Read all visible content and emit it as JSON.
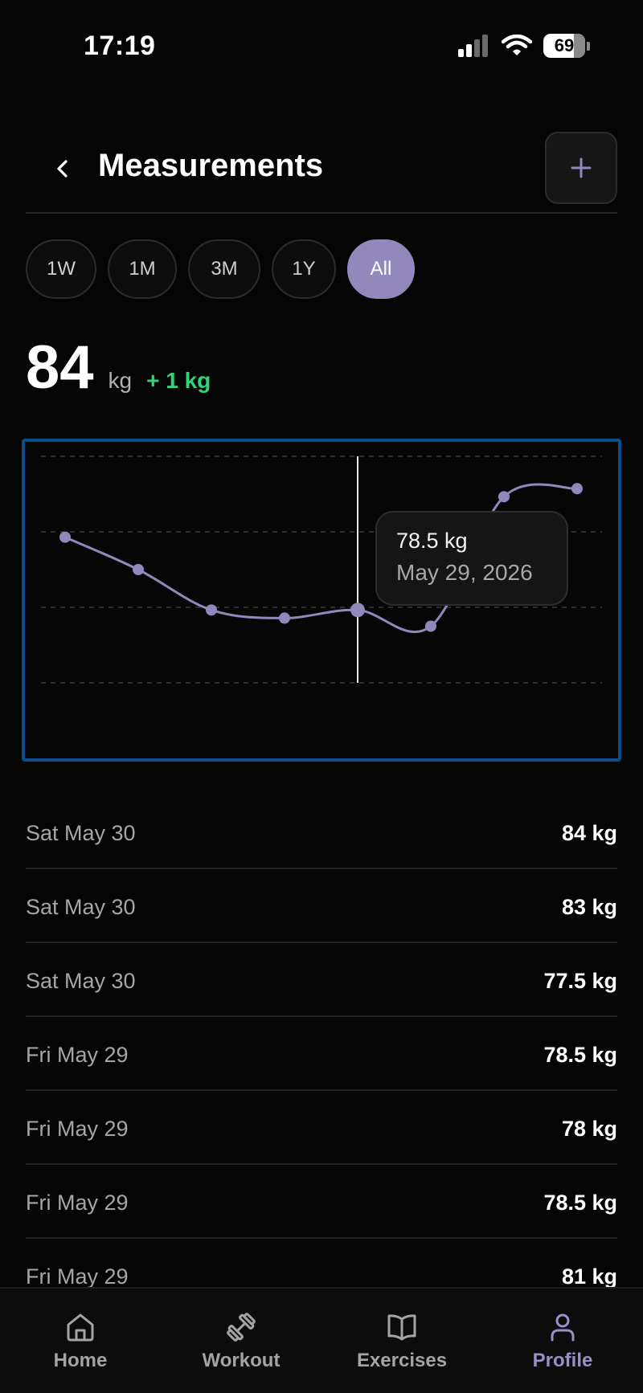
{
  "status_bar": {
    "time": "17:19",
    "battery": "69"
  },
  "header": {
    "title": "Measurements",
    "back_icon": "chevron-left-icon",
    "add_icon": "plus-icon"
  },
  "ranges": [
    {
      "label": "1W",
      "active": false
    },
    {
      "label": "1M",
      "active": false
    },
    {
      "label": "3M",
      "active": false
    },
    {
      "label": "1Y",
      "active": false
    },
    {
      "label": "All",
      "active": true
    }
  ],
  "current": {
    "value": "84",
    "unit": "kg",
    "delta": "+ 1 kg"
  },
  "chart_data": {
    "type": "line",
    "values": [
      81,
      79,
      76.5,
      76,
      76.5,
      75.5,
      83.5,
      84
    ],
    "y_range": [
      72,
      86
    ],
    "grid": "dashed-horizontal",
    "line_color": "#9288bc",
    "selected_index": 4,
    "tooltip": {
      "value": "78.5 kg",
      "date": "May 29, 2026"
    }
  },
  "entries": [
    {
      "date": "Sat May 30",
      "value": "84 kg"
    },
    {
      "date": "Sat May 30",
      "value": "83 kg"
    },
    {
      "date": "Sat May 30",
      "value": "77.5 kg"
    },
    {
      "date": "Fri May 29",
      "value": "78.5 kg"
    },
    {
      "date": "Fri May 29",
      "value": "78 kg"
    },
    {
      "date": "Fri May 29",
      "value": "78.5 kg"
    },
    {
      "date": "Fri May 29",
      "value": "81 kg"
    }
  ],
  "nav": [
    {
      "label": "Home",
      "icon": "home-icon",
      "active": false
    },
    {
      "label": "Workout",
      "icon": "dumbbell-icon",
      "active": false
    },
    {
      "label": "Exercises",
      "icon": "book-icon",
      "active": false
    },
    {
      "label": "Profile",
      "icon": "person-icon",
      "active": true
    }
  ],
  "colors": {
    "accent": "#9288bc",
    "positive": "#2fd47b",
    "chart_border": "#0b4f8a"
  }
}
